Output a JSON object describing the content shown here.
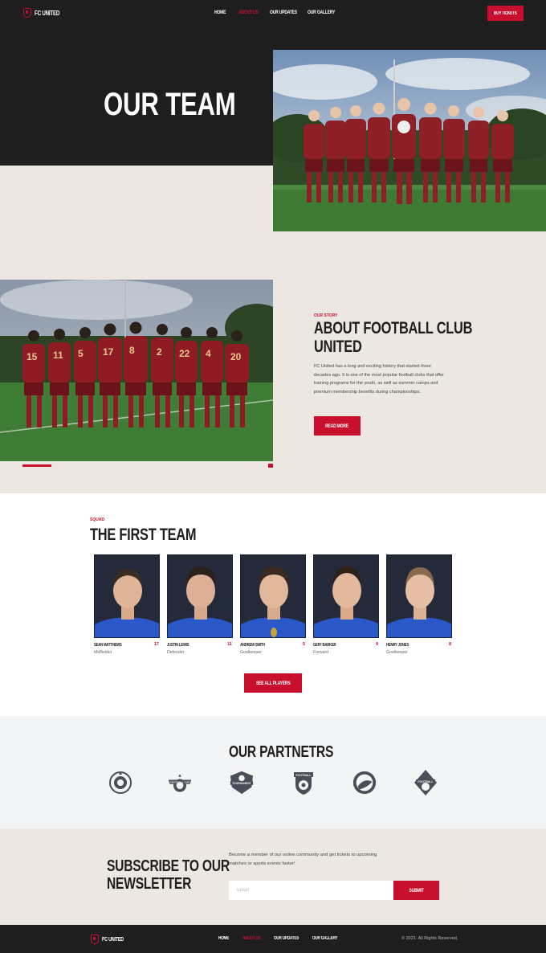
{
  "nav": {
    "logo_text": "FC UNITED",
    "links": [
      "HOME",
      "ABOUT US",
      "OUR UPDATES",
      "OUR GALLERY"
    ],
    "active_link": "ABOUT US",
    "cta": "BUY TICKETS"
  },
  "hero": {
    "title": "OUR TEAM"
  },
  "about": {
    "kicker": "OUR STORY",
    "title_line1": "ABOUT FOOTBALL CLUB",
    "title_line2": "UNITED",
    "text": "FC United has a long and exciting history that started three decades ago. It is one of the most popular football clubs that offer training programs for the youth, as well as summer camps and premium membership benefits during championships.",
    "button": "READ MORE"
  },
  "squad": {
    "kicker": "SQUAD",
    "title": "THE FIRST TEAM",
    "players": [
      {
        "name": "SEAN MATTHEWS",
        "role": "Midfielder",
        "number": "17"
      },
      {
        "name": "JUSTIN LEWIS",
        "role": "Defender",
        "number": "11"
      },
      {
        "name": "ANDREW SMITH",
        "role": "Goalkeeper",
        "number": "5"
      },
      {
        "name": "GEFF BARKER",
        "role": "Forward",
        "number": "9"
      },
      {
        "name": "HENRY JONES",
        "role": "Goalkeeper",
        "number": "8"
      }
    ],
    "button": "SEE ALL PLAYERS"
  },
  "partners": {
    "title": "OUR PARTNETRS",
    "logos": [
      {
        "icon": "soccer-club-emblem-icon",
        "label": ""
      },
      {
        "icon": "football-cup-badge-icon",
        "label": "FOOTBALL CUP"
      },
      {
        "icon": "tournament-shield-icon",
        "label": "TOURNAMENT"
      },
      {
        "icon": "football-shield-icon",
        "label": "FOOTBALL"
      },
      {
        "icon": "round-emblem-icon",
        "label": ""
      },
      {
        "icon": "football-diamond-badge-icon",
        "label": "FOOTBALL"
      }
    ]
  },
  "newsletter": {
    "title_line1": "SUBSCRIBE TO OUR",
    "title_line2": "NEWSLETTER",
    "text": "Become a member of our online community and get tickets to upcoming matches or sports events faster!",
    "email_placeholder": "Email",
    "button": "SUBMIT"
  },
  "footer": {
    "logo_text": "FC UNITED",
    "links": [
      "HOME",
      "ABOUT US",
      "OUR UPDATES",
      "OUR GALLERY"
    ],
    "copyright": "© 2021. All Rights Reserved."
  },
  "colors": {
    "accent": "#c8102e",
    "dark": "#1e1e1e",
    "beige": "#ede7e1",
    "light": "#f3f4f6"
  }
}
